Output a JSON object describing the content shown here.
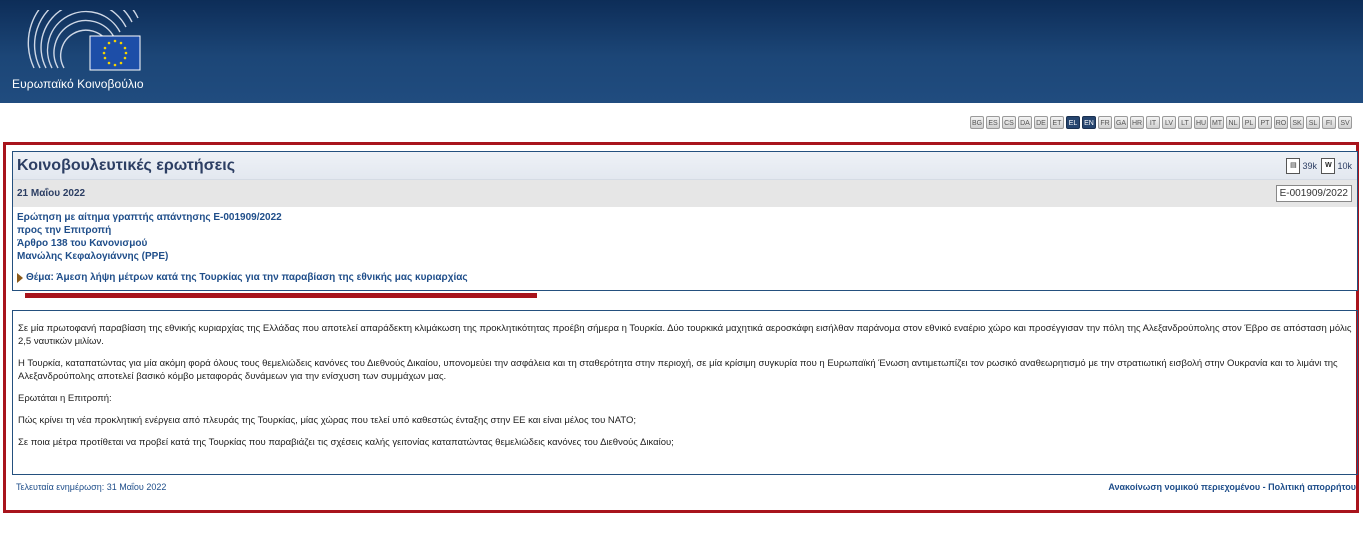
{
  "header": {
    "institution_name": "Ευρωπαϊκό Κοινοβούλιο",
    "flag_color": "#1d4ea8",
    "star_color": "#f5d400"
  },
  "languages": {
    "items": [
      "BG",
      "ES",
      "CS",
      "DA",
      "DE",
      "ET",
      "EL",
      "EN",
      "FR",
      "GA",
      "HR",
      "IT",
      "LV",
      "LT",
      "HU",
      "MT",
      "NL",
      "PL",
      "PT",
      "RO",
      "SK",
      "SL",
      "FI",
      "SV"
    ],
    "active": [
      "EL",
      "EN"
    ]
  },
  "question": {
    "section_title": "Κοινοβουλευτικές ερωτήσεις",
    "pdf_size": "39k",
    "doc_size": "10k",
    "date": "21 Μαΐου 2022",
    "reference": "E-001909/2022",
    "type_line": "Ερώτηση με αίτημα γραπτής απάντησης  E-001909/2022",
    "addressee": "προς την Επιτροπή",
    "rule": "Άρθρο 138 του Κανονισμού",
    "author": "Μανώλης Κεφαλογιάννης (PPE)",
    "subject": "Θέμα: Άμεση λήψη μέτρων κατά της Τουρκίας για την παραβίαση της εθνικής μας κυριαρχίας"
  },
  "body": {
    "p1": "Σε μία πρωτοφανή παραβίαση της εθνικής κυριαρχίας της Ελλάδας που αποτελεί απαράδεκτη κλιμάκωση της προκλητικότητας προέβη σήμερα η Τουρκία. Δύο τουρκικά μαχητικά αεροσκάφη εισήλθαν παράνομα στον εθνικό εναέριο χώρο και προσέγγισαν την πόλη της Αλεξανδρούπολης στον Έβρο σε απόσταση μόλις 2,5 ναυτικών μιλίων.",
    "p2": "Η Τουρκία, καταπατώντας για μία ακόμη φορά όλους τους θεμελιώδεις κανόνες του Διεθνούς Δικαίου, υπονομεύει την ασφάλεια και τη σταθερότητα στην περιοχή, σε μία κρίσιμη συγκυρία που η Ευρωπαϊκή Ένωση αντιμετωπίζει τον ρωσικό αναθεωρητισμό με την στρατιωτική εισβολή στην Ουκρανία και το λιμάνι της Αλεξανδρούπολης αποτελεί βασικό κόμβο μεταφοράς δυνάμεων για την ενίσχυση των συμμάχων μας.",
    "p3": "Ερωτάται η Επιτροπή:",
    "p4": "Πώς κρίνει τη νέα προκλητική ενέργεια από πλευράς της Τουρκίας, μίας χώρας που τελεί υπό καθεστώς ένταξης στην ΕΕ και είναι μέλος του ΝΑΤΟ;",
    "p5": "Σε ποια μέτρα προτίθεται να προβεί κατά της Τουρκίας που παραβιάζει τις σχέσεις καλής γειτονίας καταπατώντας θεμελιώδεις κανόνες του Διεθνούς Δικαίου;"
  },
  "footer": {
    "last_update": "Τελευταία ενημέρωση: 31 Μαΐου 2022",
    "legal_links": "Ανακοίνωση νομικού περιεχομένου - Πολιτική απορρήτου"
  }
}
